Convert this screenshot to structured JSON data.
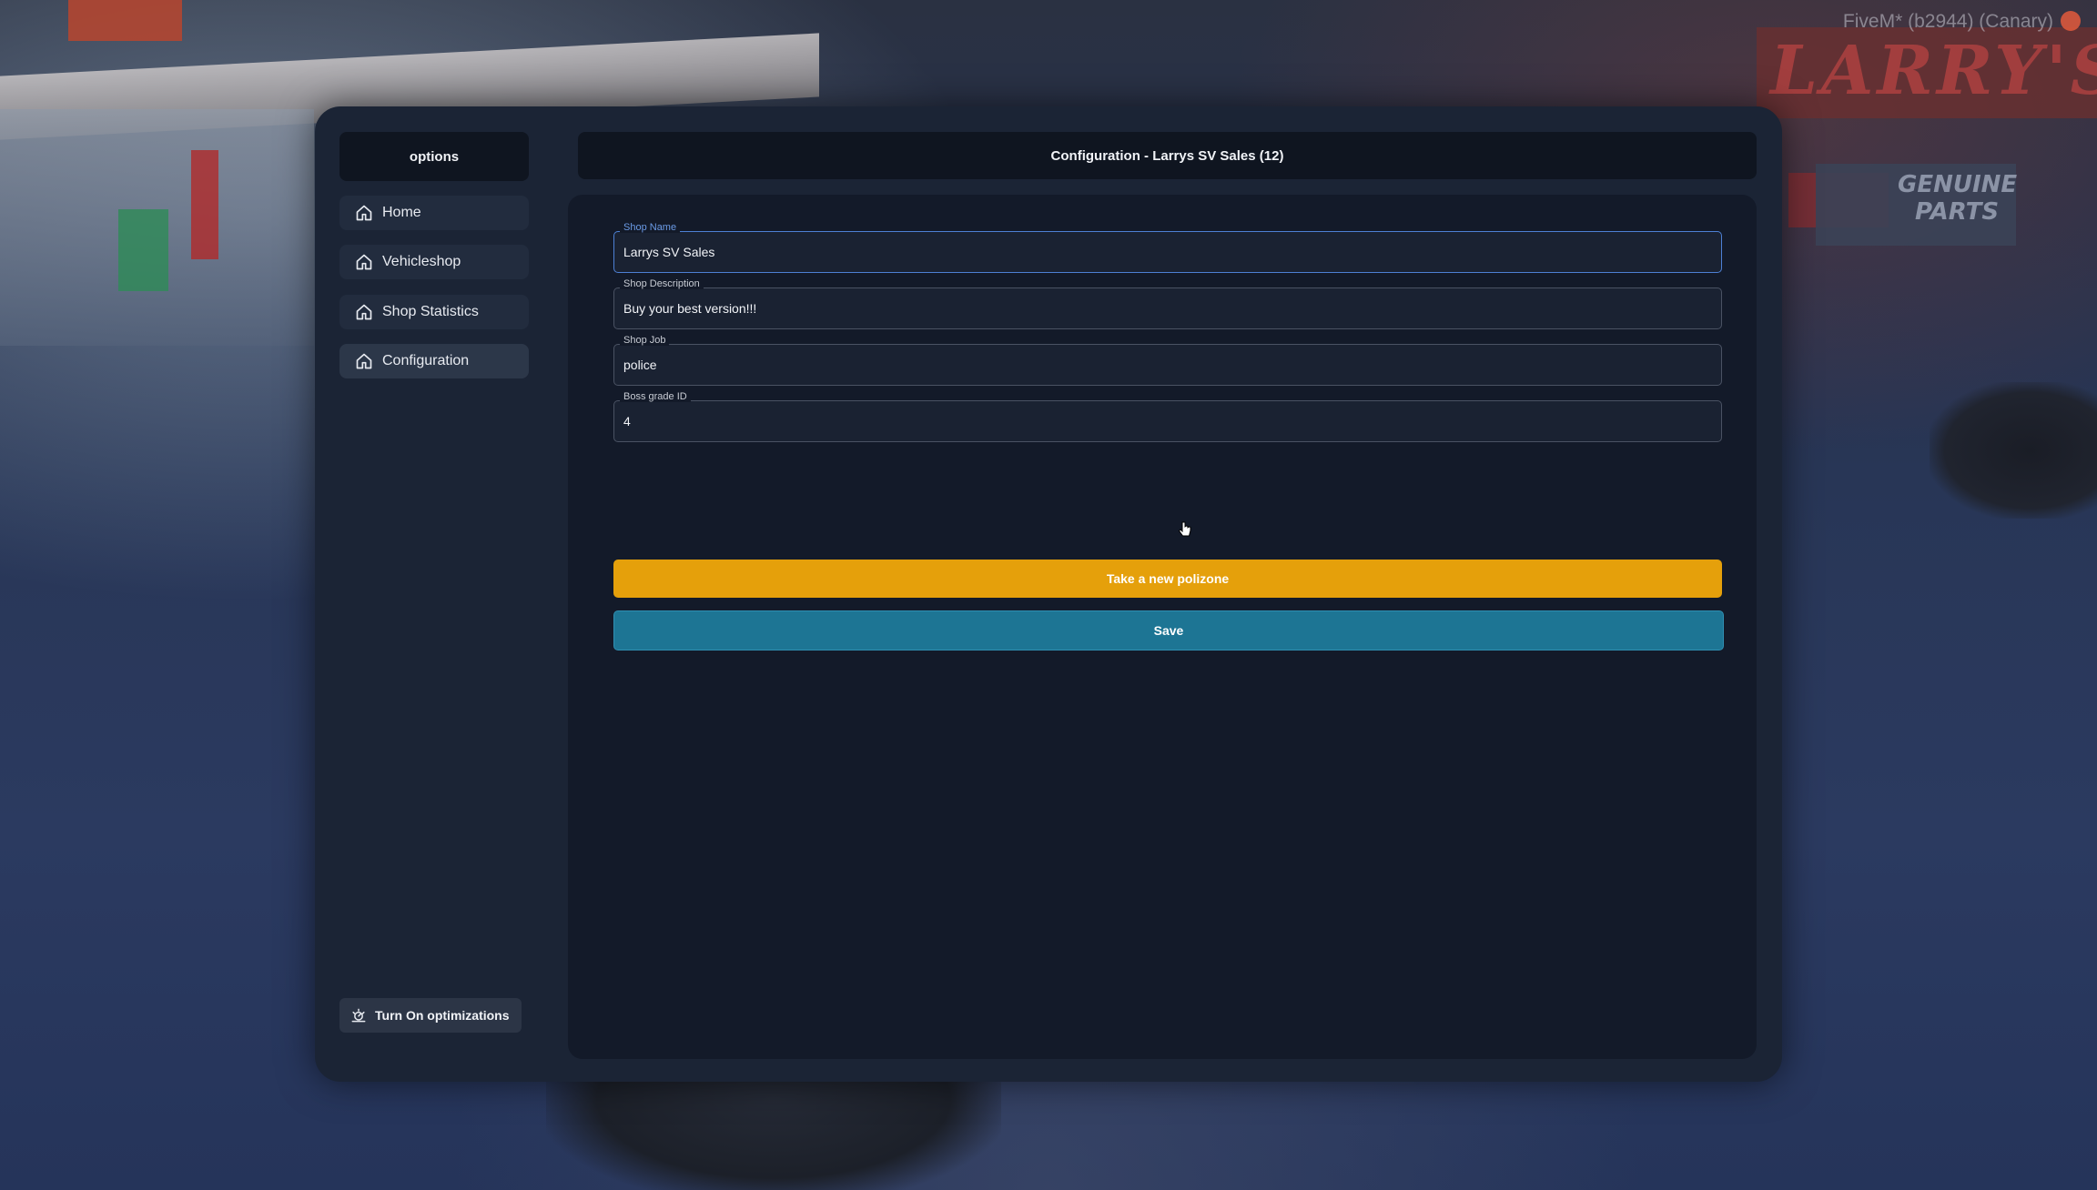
{
  "app": {
    "overlay_tag": "FiveM* (b2944) (Canary)"
  },
  "sidebar": {
    "title": "options",
    "items": [
      {
        "label": "Home",
        "icon": "home-icon"
      },
      {
        "label": "Vehicleshop",
        "icon": "home-icon"
      },
      {
        "label": "Shop Statistics",
        "icon": "home-icon"
      },
      {
        "label": "Configuration",
        "icon": "home-icon",
        "active": true
      }
    ],
    "optimizations_label": "Turn On optimizations"
  },
  "main": {
    "title": "Configuration - Larrys SV Sales (12)",
    "fields": {
      "shop_name": {
        "label": "Shop Name",
        "value": "Larrys SV Sales"
      },
      "shop_description": {
        "label": "Shop Description",
        "value": "Buy your best version!!!"
      },
      "shop_job": {
        "label": "Shop Job",
        "value": "police"
      },
      "boss_grade": {
        "label": "Boss grade ID",
        "value": "4"
      }
    },
    "polizone_button": "Take a new polizone",
    "save_button": "Save"
  },
  "colors": {
    "accent_orange": "#e5a00b",
    "accent_teal": "#1d7594",
    "focus_blue": "#4d80d4",
    "panel_dark": "#131a29"
  }
}
